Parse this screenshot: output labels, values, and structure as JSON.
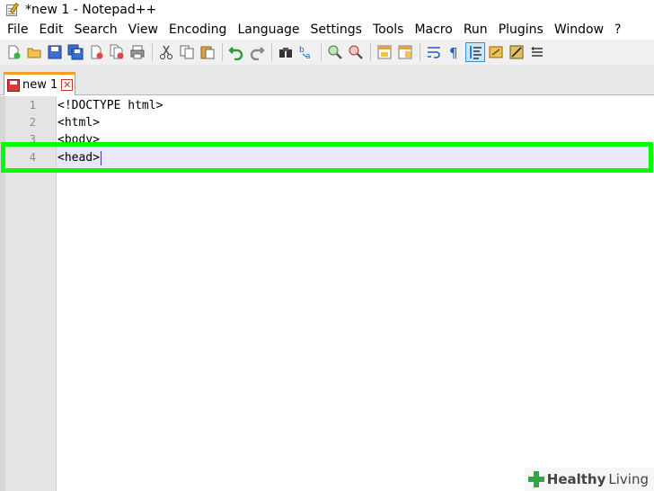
{
  "window": {
    "title": "*new 1 - Notepad++"
  },
  "menu": [
    "File",
    "Edit",
    "Search",
    "View",
    "Encoding",
    "Language",
    "Settings",
    "Tools",
    "Macro",
    "Run",
    "Plugins",
    "Window",
    "?"
  ],
  "toolbar": {
    "icons": [
      "new-file-icon",
      "open-file-icon",
      "save-icon",
      "save-all-icon",
      "close-icon",
      "close-all-icon",
      "print-icon",
      "cut-icon",
      "copy-icon",
      "paste-icon",
      "undo-icon",
      "redo-icon",
      "find-icon",
      "replace-icon",
      "zoom-in-icon",
      "zoom-out-icon",
      "sync-vertical-icon",
      "sync-horizontal-icon",
      "word-wrap-icon",
      "show-all-chars-icon",
      "indent-guide-icon",
      "user-language-icon",
      "doc-map-icon",
      "function-list-icon"
    ],
    "active_icon": "indent-guide-icon"
  },
  "tabs": [
    {
      "label": "new 1",
      "close_glyph": "✕"
    }
  ],
  "editor": {
    "line_numbers": [
      "1",
      "2",
      "3",
      "4"
    ],
    "lines": [
      "<!DOCTYPE html>",
      "<html>",
      "<body>",
      "<head>"
    ],
    "current_line": 4
  },
  "watermark": {
    "part1": "Healthy",
    "part2": "Living"
  },
  "colors": {
    "highlight": "#00ff00",
    "current_line": "#e8e8ff",
    "tab_accent": "#f4a020"
  }
}
